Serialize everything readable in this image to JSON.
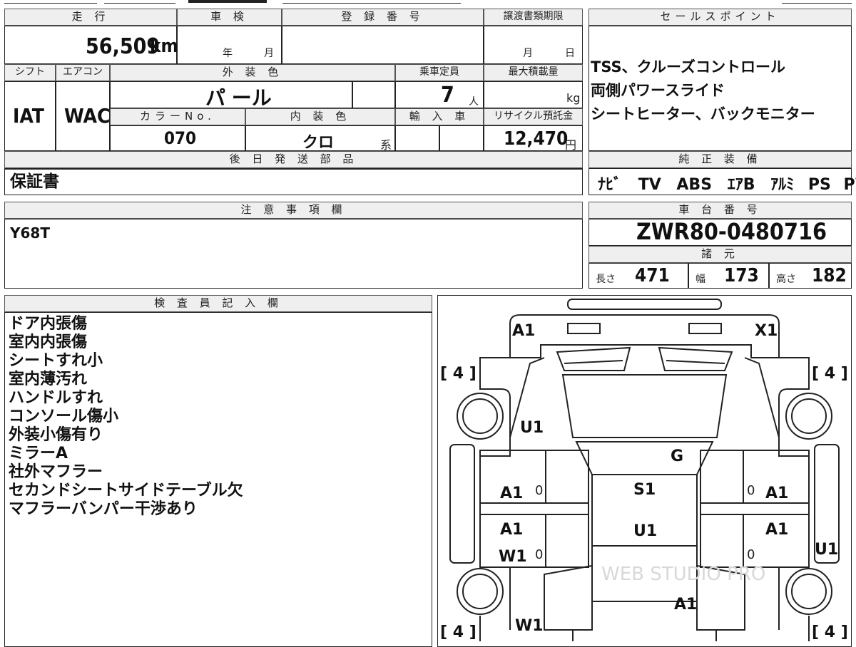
{
  "mileage": {
    "header": "走 行",
    "value": "56,509",
    "unit": "km"
  },
  "inspection": {
    "header": "車 検",
    "year": "年",
    "month": "月"
  },
  "registration": {
    "header": "登 録 番 号"
  },
  "transfer_deadline": {
    "header": "譲渡書類期限",
    "month": "月",
    "day": "日"
  },
  "sales_points": {
    "header": "セールスポイント",
    "lines": [
      "TSS、クルーズコントロール",
      "両側パワースライド",
      "シートヒーター、バックモニター"
    ]
  },
  "shift": {
    "header": "シフト",
    "value": "IAT"
  },
  "aircon": {
    "header": "エアコン",
    "value": "WAC"
  },
  "exterior_color": {
    "header": "外 装 色",
    "value": "パ ール"
  },
  "capacity": {
    "header": "乗車定員",
    "value": "7",
    "unit": "人"
  },
  "max_load": {
    "header": "最大積載量",
    "unit": "kg"
  },
  "color_no": {
    "header": "カラーNo.",
    "value": "070"
  },
  "interior_color": {
    "header": "内 装 色",
    "value": "クロ",
    "suffix": "系"
  },
  "import": {
    "header": "輸 入 車"
  },
  "recycle_fee": {
    "header": "リサイクル預託金",
    "value": "12,470",
    "unit": "円"
  },
  "later_parts": {
    "header": "後 日 発 送 部 品",
    "value": "保証書"
  },
  "genuine_equipment": {
    "header": "純 正 装 備",
    "items": [
      "ﾅﾋﾞ",
      "TV",
      "ABS",
      "ｴｱB",
      "ｱﾙﾐ",
      "PS",
      "PW"
    ]
  },
  "notes": {
    "header": "注 意 事 項 欄",
    "value": "Y68T"
  },
  "chassis": {
    "header": "車 台 番 号",
    "value": "ZWR80-0480716"
  },
  "specs": {
    "header": "諸 元",
    "length_label": "長さ",
    "length": "471",
    "width_label": "幅",
    "width": "173",
    "height_label": "高さ",
    "height": "182"
  },
  "inspector": {
    "header": "検 査 員 記 入 欄",
    "lines": [
      "ドア内張傷",
      "室内内張傷",
      "シートすれ小",
      "室内薄汚れ",
      "ハンドルすれ",
      "コンソール傷小",
      "外装小傷有り",
      "ミラーA",
      "社外マフラー",
      "セカンドシートサイドテーブル欠",
      "マフラーバンパー干渉あり"
    ]
  },
  "diagram": {
    "front_left": "A1",
    "front_right": "X1",
    "tire_fl": "4",
    "tire_fr": "4",
    "tire_rl": "4",
    "tire_rr": "4",
    "hood_left": "U1",
    "windshield": "G",
    "roof": "S1",
    "roof_rear": "U1",
    "door_fl": "A1",
    "door_fr": "A1",
    "door_rl": "A1",
    "door_rl2": "W1",
    "door_rr": "A1",
    "rear_right": "U1",
    "rear_left": "W1",
    "rear_center": "A1",
    "zero": "0",
    "watermark": "WEB STUDIO PRO"
  }
}
